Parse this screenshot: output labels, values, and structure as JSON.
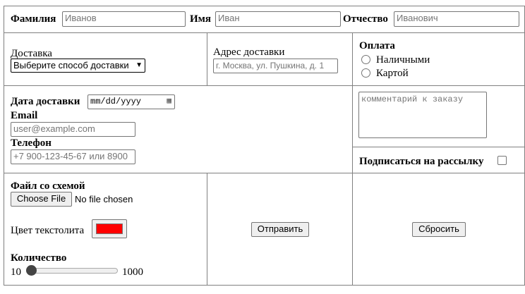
{
  "name_row": {
    "surname_label": "Фамилия",
    "surname_placeholder": "Иванов",
    "name_label": "Имя",
    "name_placeholder": "Иван",
    "patronymic_label": "Отчество",
    "patronymic_placeholder": "Иванович"
  },
  "delivery": {
    "label": "Доставка",
    "select_value": "Выберите способ доставки",
    "address_label": "Адрес доставки",
    "address_placeholder": "г. Москва, ул. Пушкина, д. 1"
  },
  "payment": {
    "label": "Оплата",
    "options": [
      "Наличными",
      "Картой"
    ]
  },
  "contact": {
    "date_label": "Дата доставки",
    "date_placeholder": "mm/dd/yyyy",
    "email_label": "Email",
    "email_placeholder": "user@example.com",
    "phone_label": "Телефон",
    "phone_placeholder": "+7 900-123-45-67 или 8900"
  },
  "comment": {
    "placeholder": "комментарий к заказу"
  },
  "subscribe": {
    "label": "Подписаться на рассылку",
    "checked": false
  },
  "file": {
    "label": "Файл со схемой",
    "button": "Choose File",
    "status": "No file chosen"
  },
  "color": {
    "label": "Цвет текстолита",
    "value": "#ff0000"
  },
  "quantity": {
    "label": "Количество",
    "min": "10",
    "max": "1000",
    "value": 10
  },
  "actions": {
    "submit": "Отправить",
    "reset": "Сбросить"
  }
}
